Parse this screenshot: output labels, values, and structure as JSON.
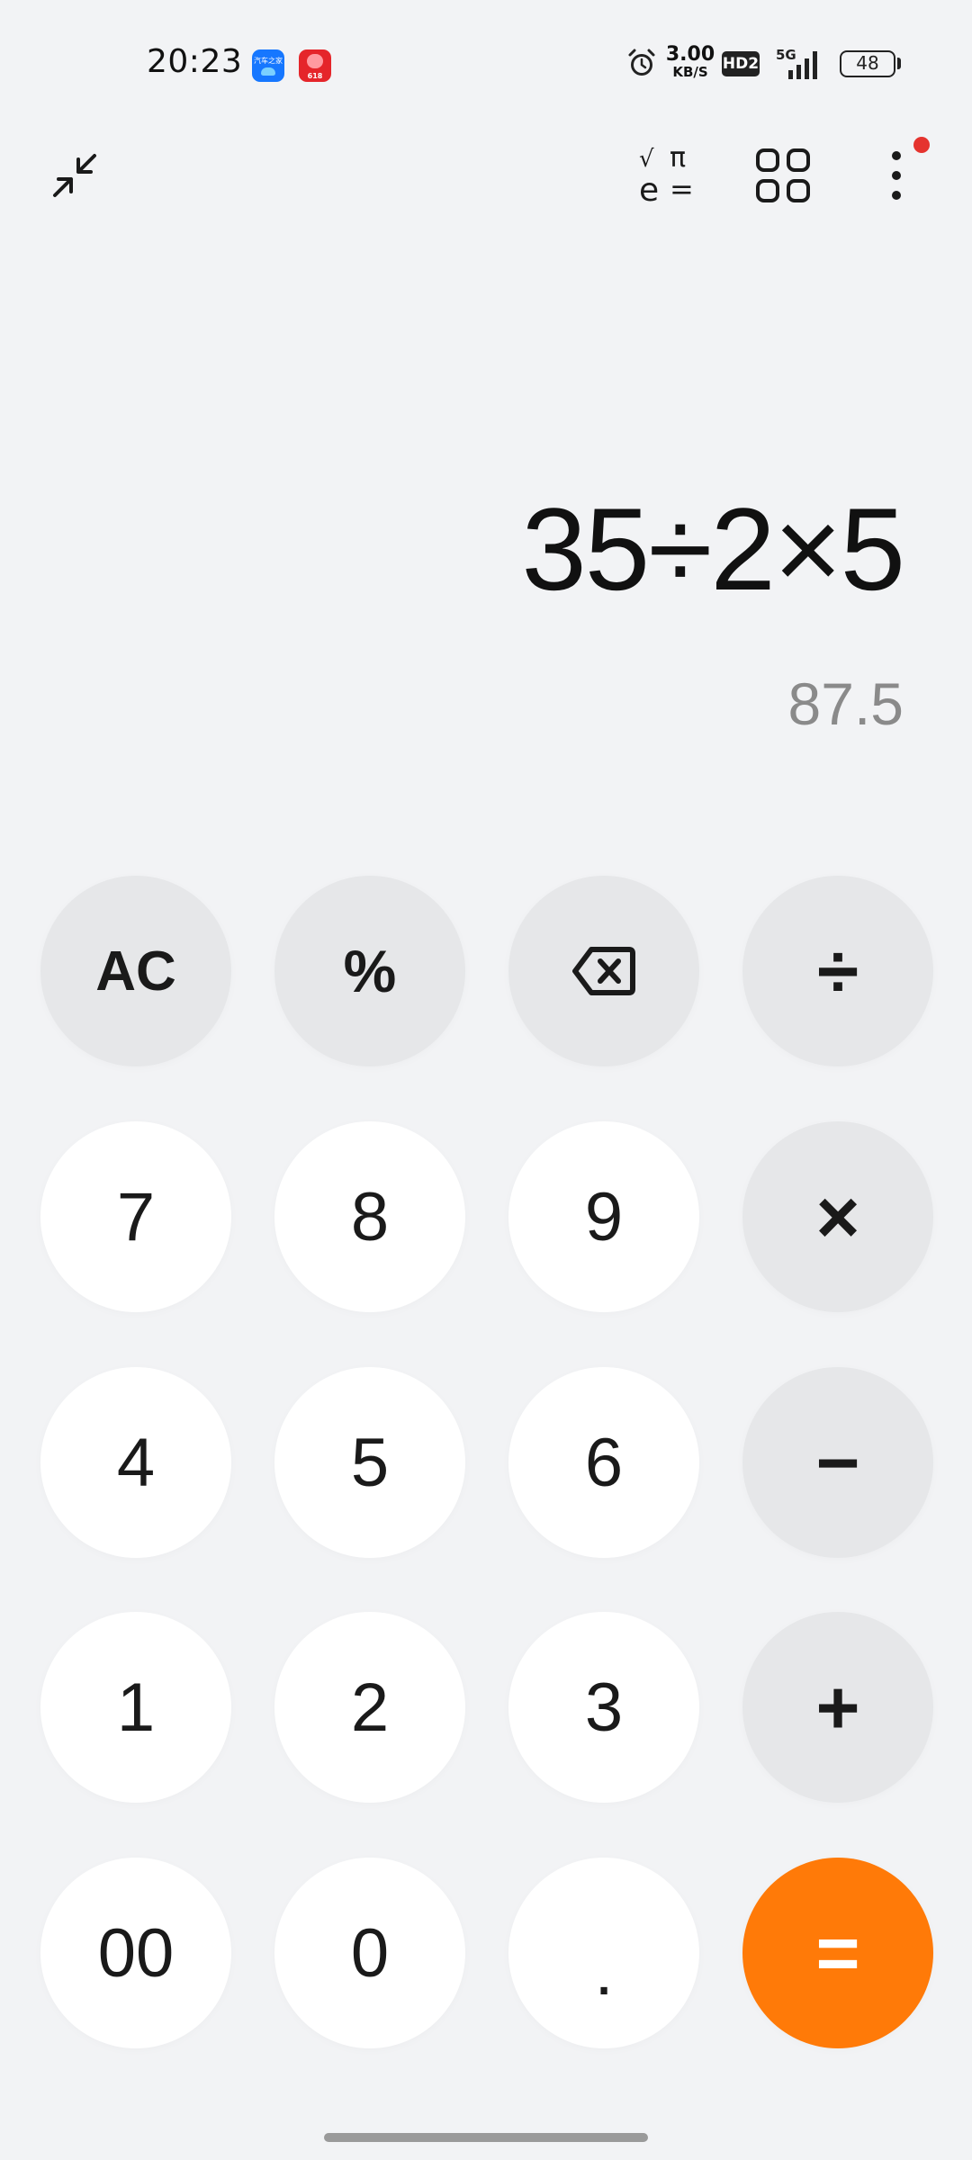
{
  "status_bar": {
    "time": "20:23",
    "apps": [
      {
        "icon": "autohome-app-icon",
        "label": "汽车之家"
      },
      {
        "icon": "shop-618-app-icon",
        "label": "618"
      }
    ],
    "net_speed_value": "3.00",
    "net_speed_unit": "KB/S",
    "hd_label": "HD2",
    "network_label": "5G",
    "battery_level": "48"
  },
  "toolbar": {
    "collapse_icon": "collapse-arrows-icon",
    "scientific_icon": "scientific-calculator-icon",
    "scientific_symbols": [
      "√",
      "π",
      "e",
      "="
    ],
    "apps_icon": "grid-apps-icon",
    "more_icon": "more-vertical-icon",
    "notification_color": "#e5332e"
  },
  "display": {
    "expression": "35÷2×5",
    "result": "87.5"
  },
  "keypad": {
    "ac": "AC",
    "percent": "%",
    "backspace_icon": "backspace-icon",
    "divide": "÷",
    "multiply": "×",
    "minus": "−",
    "plus": "+",
    "equals": "=",
    "digits": {
      "seven": "7",
      "eight": "8",
      "nine": "9",
      "four": "4",
      "five": "5",
      "six": "6",
      "one": "1",
      "two": "2",
      "three": "3",
      "double_zero": "00",
      "zero": "0",
      "dot": "."
    }
  },
  "colors": {
    "background": "#f2f3f5",
    "digit_key": "#ffffff",
    "function_key": "#e6e7e9",
    "equals_key": "#ff7a08",
    "result_text": "#8a8a8a"
  }
}
